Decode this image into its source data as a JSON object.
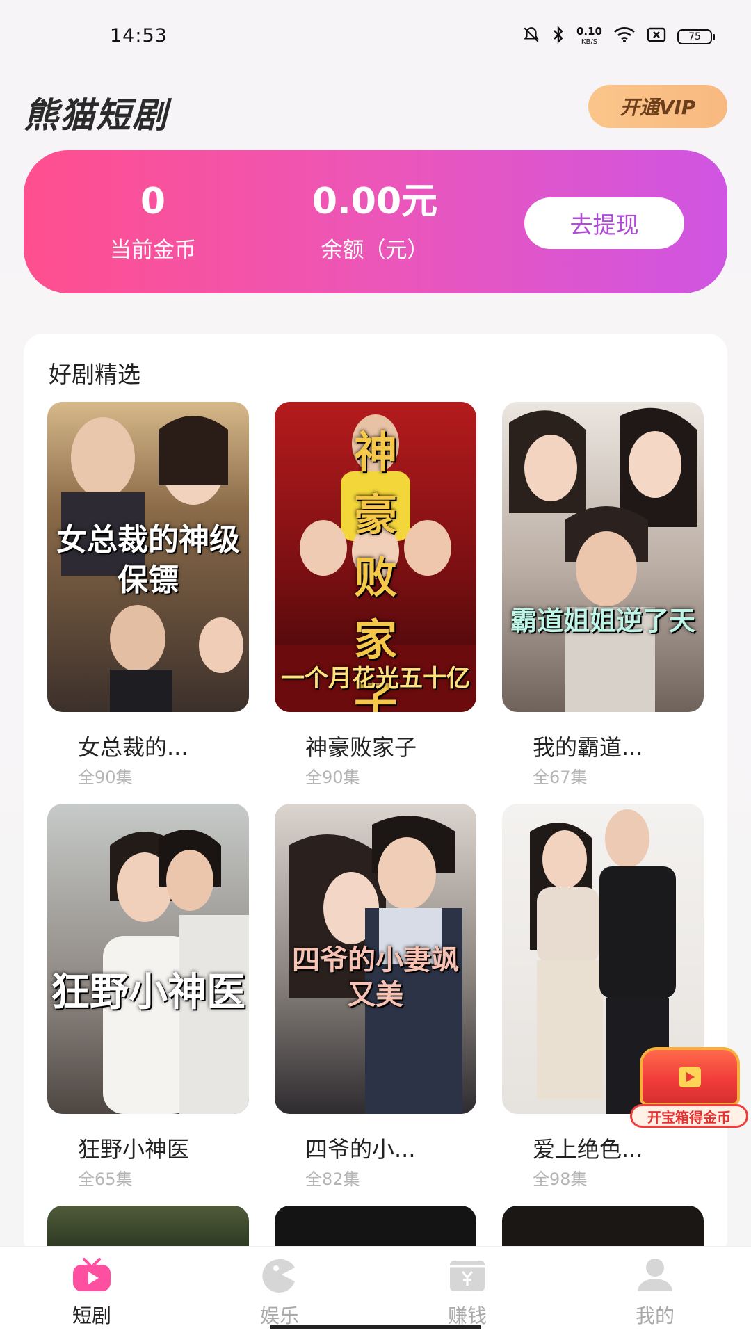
{
  "status_bar": {
    "time": "14:53",
    "net_speed": "0.10",
    "net_unit": "KB/S",
    "battery": "75"
  },
  "header": {
    "app_title": "熊猫短剧",
    "vip_label": "开通VIP"
  },
  "wallet": {
    "coins_value": "0",
    "coins_label": "当前金币",
    "balance_value": "0.00元",
    "balance_label": "余额（元）",
    "withdraw_label": "去提现"
  },
  "featured": {
    "section_title": "好剧精选",
    "items": [
      {
        "title": "女总裁的...",
        "episodes": "全90集",
        "poster_text": "女总裁的神级保镖",
        "colors": [
          "#c9a97a",
          "#3b2f2a"
        ]
      },
      {
        "title": "神豪败家子",
        "episodes": "全90集",
        "poster_text": "神豪 败家子",
        "poster_sub": "一个月花光五十亿",
        "colors": [
          "#a8181a",
          "#4a0808"
        ]
      },
      {
        "title": "我的霸道...",
        "episodes": "全67集",
        "poster_text": "霸道姐姐逆了天",
        "colors": [
          "#e8e2dc",
          "#7a6d66"
        ]
      },
      {
        "title": "狂野小神医",
        "episodes": "全65集",
        "poster_text": "狂野小神医",
        "colors": [
          "#bfc3c2",
          "#6d6660"
        ]
      },
      {
        "title": "四爷的小...",
        "episodes": "全82集",
        "poster_text": "四爷的小妻飒又美",
        "colors": [
          "#d9d2cc",
          "#3d3a3f"
        ]
      },
      {
        "title": "爱上绝色...",
        "episodes": "全98集",
        "poster_text": "",
        "colors": [
          "#f2f0ee",
          "#c9c3be"
        ]
      }
    ]
  },
  "treasure": {
    "label": "开宝箱得金币"
  },
  "bottom_nav": {
    "items": [
      {
        "label": "短剧",
        "icon": "tv-icon",
        "active": true
      },
      {
        "label": "娱乐",
        "icon": "game-icon",
        "active": false
      },
      {
        "label": "赚钱",
        "icon": "wallet-icon",
        "active": false
      },
      {
        "label": "我的",
        "icon": "user-icon",
        "active": false
      }
    ]
  },
  "colors": {
    "card_gradient_start": "#ff4f8e",
    "card_gradient_end": "#cf55e2",
    "vip_gold": "#fbc58a",
    "nav_active": "#ff4fa0"
  }
}
